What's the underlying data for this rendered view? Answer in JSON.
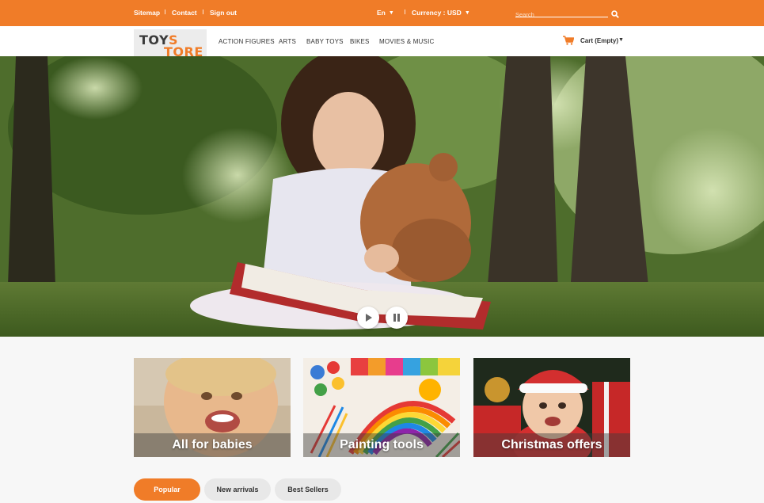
{
  "topbar": {
    "links": [
      "Sitemap",
      "Contact",
      "Sign out"
    ],
    "language": "En",
    "currency": "Currency : USD",
    "search_placeholder": "Search"
  },
  "logo": {
    "line1_a": "TOY",
    "line1_b": "S",
    "line2": "TORE"
  },
  "nav": [
    "ACTION FIGURES",
    "ARTS",
    "BABY TOYS",
    "BIKES",
    "MOVIES & MUSIC"
  ],
  "cart": {
    "label": "Cart (Empty)"
  },
  "slider": {
    "controls": [
      "play-icon",
      "pause-icon"
    ]
  },
  "banners": [
    "All for babies",
    "Painting tools",
    "Christmas offers"
  ],
  "tabs": [
    {
      "label": "Popular",
      "active": true
    },
    {
      "label": "New arrivals",
      "active": false
    },
    {
      "label": "Best Sellers",
      "active": false
    }
  ],
  "colors": {
    "accent": "#f07c28",
    "tab_inactive": "#e8e8e8"
  }
}
